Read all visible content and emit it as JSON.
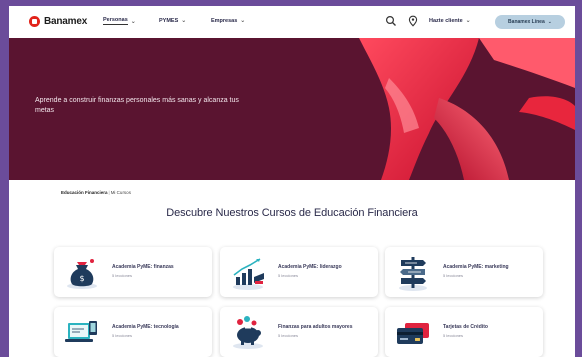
{
  "nav": {
    "logo_text": "Banamex",
    "items": [
      {
        "label": "Personas",
        "active": true
      },
      {
        "label": "PYMES",
        "active": false
      },
      {
        "label": "Empresas",
        "active": false
      }
    ],
    "help_label": "Hazte cliente",
    "access_label": "Banamex Línea"
  },
  "hero": {
    "text": "Aprende a construir finanzas personales más sanas y alcanza tus metas",
    "background_color": "#5a1430",
    "accent_color": "#e0233f"
  },
  "breadcrumb": {
    "root": "Educación Financiera",
    "current": "Mi Cursos"
  },
  "heading": "Descubre Nuestros Cursos de Educación Financiera",
  "courses": [
    {
      "title": "Academia PyME: finanzas",
      "subtitle": "5 lecciones",
      "icon": "money-bag-icon"
    },
    {
      "title": "Academia PyME: liderazgo",
      "subtitle": "5 lecciones",
      "icon": "graduation-growth-icon"
    },
    {
      "title": "Academia PyME: marketing",
      "subtitle": "5 lecciones",
      "icon": "signpost-icon"
    },
    {
      "title": "Academia PyME: tecnología",
      "subtitle": "5 lecciones",
      "icon": "laptop-icon"
    },
    {
      "title": "Finanzas para adultos mayores",
      "subtitle": "5 lecciones",
      "icon": "piggy-coins-icon"
    },
    {
      "title": "Tarjetas de Crédito",
      "subtitle": "5 lecciones",
      "icon": "credit-cards-icon"
    }
  ]
}
